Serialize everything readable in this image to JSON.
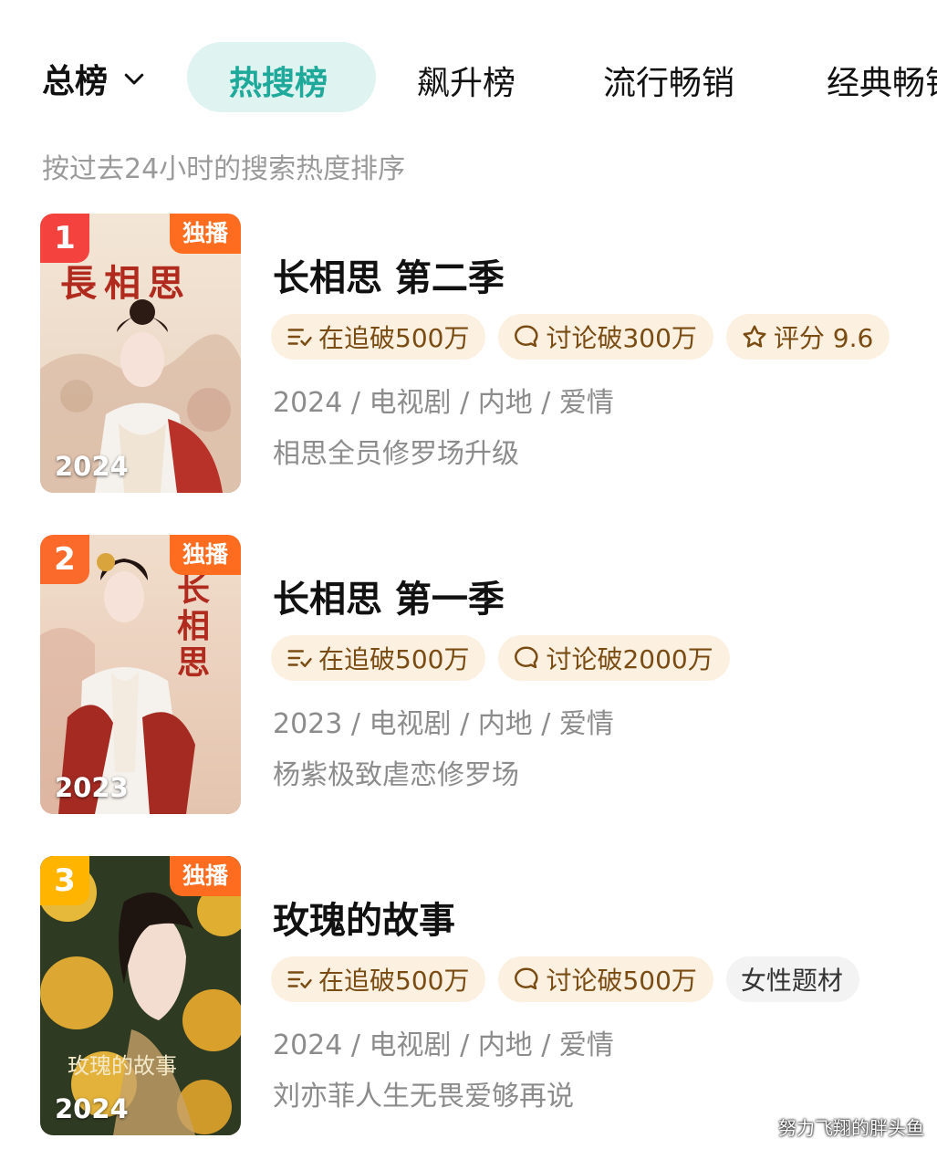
{
  "tabs": {
    "all_label": "总榜",
    "items": [
      "热搜榜",
      "飙升榜",
      "流行畅销",
      "经典畅销"
    ],
    "active": 0
  },
  "subtitle": "按过去24小时的搜索热度排序",
  "exclusive_label": "独播",
  "items": [
    {
      "rank": "1",
      "rank_color": "#f4423e",
      "poster_year": "2024",
      "poster_title": "長相思",
      "title": "长相思 第二季",
      "chips": [
        {
          "icon": "follow-list-icon",
          "text": "在追破500万"
        },
        {
          "icon": "comment-icon",
          "text": "讨论破300万"
        },
        {
          "icon": "star-icon",
          "text": "评分 9.6"
        }
      ],
      "meta": "2024 / 电视剧 / 内地 / 爱情",
      "desc": "相思全员修罗场升级"
    },
    {
      "rank": "2",
      "rank_color": "#fb6a2b",
      "poster_year": "2023",
      "poster_title": "长相思",
      "title": "长相思 第一季",
      "chips": [
        {
          "icon": "follow-list-icon",
          "text": "在追破500万"
        },
        {
          "icon": "comment-icon",
          "text": "讨论破2000万"
        }
      ],
      "meta": "2023 / 电视剧 / 内地 / 爱情",
      "desc": "杨紫极致虐恋修罗场"
    },
    {
      "rank": "3",
      "rank_color": "#ffb400",
      "poster_year": "2024",
      "poster_title": "玫瑰的故事",
      "title": "玫瑰的故事",
      "chips": [
        {
          "icon": "follow-list-icon",
          "text": "在追破500万"
        },
        {
          "icon": "comment-icon",
          "text": "讨论破500万"
        }
      ],
      "tag": "女性题材",
      "meta": "2024 / 电视剧 / 内地 / 爱情",
      "desc": "刘亦菲人生无畏爱够再说"
    }
  ],
  "watermark": "努力飞翔的胖头鱼"
}
